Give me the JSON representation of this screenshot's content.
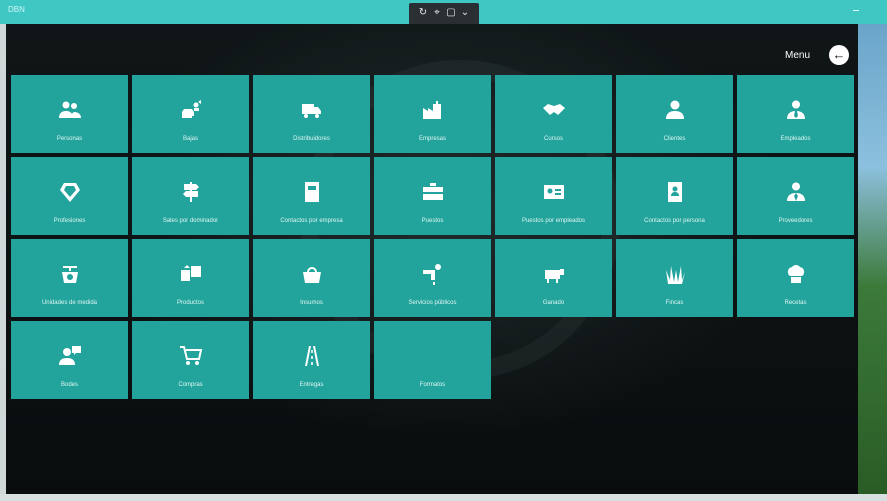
{
  "titlebar": {
    "app_title": "DBN"
  },
  "header": {
    "menu_label": "Menu"
  },
  "tiles": [
    {
      "label": "Personas",
      "icon": "people-icon"
    },
    {
      "label": "Bajas",
      "icon": "herd-icon"
    },
    {
      "label": "Distribuidores",
      "icon": "truck-icon"
    },
    {
      "label": "Empresas",
      "icon": "factory-icon"
    },
    {
      "label": "Cursos",
      "icon": "handshake-icon"
    },
    {
      "label": "Clientes",
      "icon": "person-icon"
    },
    {
      "label": "Empleados",
      "icon": "employee-icon"
    },
    {
      "label": "Profesiones",
      "icon": "badge-icon"
    },
    {
      "label": "Sales por dominador",
      "icon": "signpost-icon"
    },
    {
      "label": "Contactos por empresa",
      "icon": "book-icon"
    },
    {
      "label": "Puestos",
      "icon": "briefcase-icon"
    },
    {
      "label": "Puestos por empleados",
      "icon": "id-card-icon"
    },
    {
      "label": "Contactos por persona",
      "icon": "contact-book-icon"
    },
    {
      "label": "Proveedores",
      "icon": "supplier-icon"
    },
    {
      "label": "Unidades de medida",
      "icon": "scale-icon"
    },
    {
      "label": "Productos",
      "icon": "products-icon"
    },
    {
      "label": "Insumos",
      "icon": "basket-icon"
    },
    {
      "label": "Servicios públicos",
      "icon": "faucet-icon"
    },
    {
      "label": "Ganado",
      "icon": "cow-icon"
    },
    {
      "label": "Fincas",
      "icon": "grass-icon"
    },
    {
      "label": "Recetas",
      "icon": "chef-hat-icon"
    },
    {
      "label": "Bodes",
      "icon": "user-chat-icon"
    },
    {
      "label": "Compras",
      "icon": "cart-icon"
    },
    {
      "label": "Entregas",
      "icon": "road-icon"
    },
    {
      "label": "Formatos",
      "icon": "blank-icon"
    }
  ]
}
